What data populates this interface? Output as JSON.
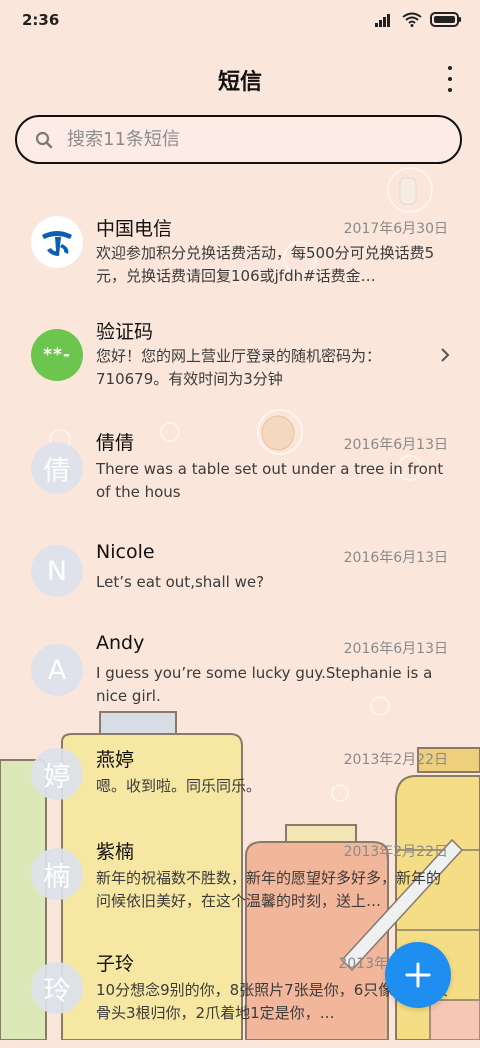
{
  "status_bar": {
    "time": "2:36"
  },
  "header": {
    "title": "短信"
  },
  "search": {
    "placeholder": "搜索11条短信"
  },
  "messages": [
    {
      "sender": "中国电信",
      "date": "2017年6月30日",
      "preview": "欢迎参加积分兑换话费活动，每500分可兑换话费5元，兑换话费请回复106或jfdh#话费金…",
      "avatar": "telecom-logo",
      "avatar_text": ""
    },
    {
      "sender": "验证码",
      "date": "",
      "preview": "您好！您的网上营业厅登录的随机密码为：710679。有效时间为3分钟",
      "avatar": "code",
      "avatar_text": "**-"
    },
    {
      "sender": "倩倩",
      "date": "2016年6月13日",
      "preview": "There was a table set out under a tree in front of the hous",
      "avatar": "letter",
      "avatar_text": "倩"
    },
    {
      "sender": "Nicole",
      "date": "2016年6月13日",
      "preview": "Let’s eat out,shall we?",
      "avatar": "letter",
      "avatar_text": "N"
    },
    {
      "sender": "Andy",
      "date": "2016年6月13日",
      "preview": "I guess you’re some lucky guy.Stephanie is a nice girl.",
      "avatar": "letter",
      "avatar_text": "A"
    },
    {
      "sender": "燕婷",
      "date": "2013年2月22日",
      "preview": "嗯。收到啦。同乐同乐。",
      "avatar": "letter",
      "avatar_text": "婷"
    },
    {
      "sender": "紫楠",
      "date": "2013年2月22日",
      "preview": "新年的祝福数不胜数，新年的愿望好多好多，新年的问候依旧美好，在这个温馨的时刻，送上…",
      "avatar": "letter",
      "avatar_text": "楠"
    },
    {
      "sender": "子玲",
      "date": "2013年",
      "preview": "10分想念9别的你，8张照片7张是你，6只像你，4根骨头3根归你，2爪着地1定是你，…",
      "avatar": "letter",
      "avatar_text": "玲"
    }
  ],
  "colors": {
    "accent": "#1e8ef0",
    "background": "#fbe6dc",
    "code_avatar": "#6cc64d",
    "telecom_blue": "#0a5fb4"
  },
  "icons": {
    "search": "search-icon",
    "more": "more-vertical-icon",
    "chevron": "chevron-right-icon",
    "fab": "plus-icon"
  }
}
